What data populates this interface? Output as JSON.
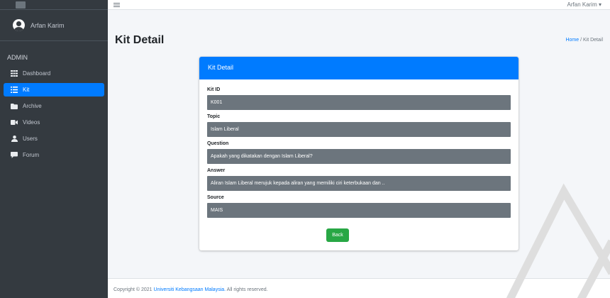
{
  "sidebar": {
    "user_name": "Arfan Karim",
    "section_header": "ADMIN",
    "items": [
      {
        "label": "Dashboard",
        "icon": "grid-icon"
      },
      {
        "label": "Kit",
        "icon": "list-icon",
        "active": true
      },
      {
        "label": "Archive",
        "icon": "folder-icon"
      },
      {
        "label": "Videos",
        "icon": "video-icon"
      },
      {
        "label": "Users",
        "icon": "user-icon"
      },
      {
        "label": "Forum",
        "icon": "comment-icon"
      }
    ]
  },
  "topbar": {
    "user_menu": "Arfan Karim ▾"
  },
  "page": {
    "title": "Kit Detail",
    "breadcrumb_home": "Home",
    "breadcrumb_sep": " / ",
    "breadcrumb_current": "Kit Detail"
  },
  "card": {
    "header": "Kit Detail",
    "fields": [
      {
        "label": "Kit ID",
        "value": "K001"
      },
      {
        "label": "Topic",
        "value": "Islam Liberal"
      },
      {
        "label": "Question",
        "value": "Apakah yang dikatakan dengan Islam Liberal?"
      },
      {
        "label": "Answer",
        "value": "Aliran Islam Liberal merujuk kepada aliran yang memiliki ciri keterbukaan dan .."
      },
      {
        "label": "Source",
        "value": "MAIS"
      }
    ],
    "back_label": "Back"
  },
  "footer": {
    "prefix": "Copyright © 2021 ",
    "org": "Universiti Kebangsaan Malaysia.",
    "suffix": " All rights reserved."
  },
  "colors": {
    "sidebar_bg": "#343a40",
    "primary": "#007bff",
    "success": "#28a745",
    "field_bg": "#6c757d"
  }
}
